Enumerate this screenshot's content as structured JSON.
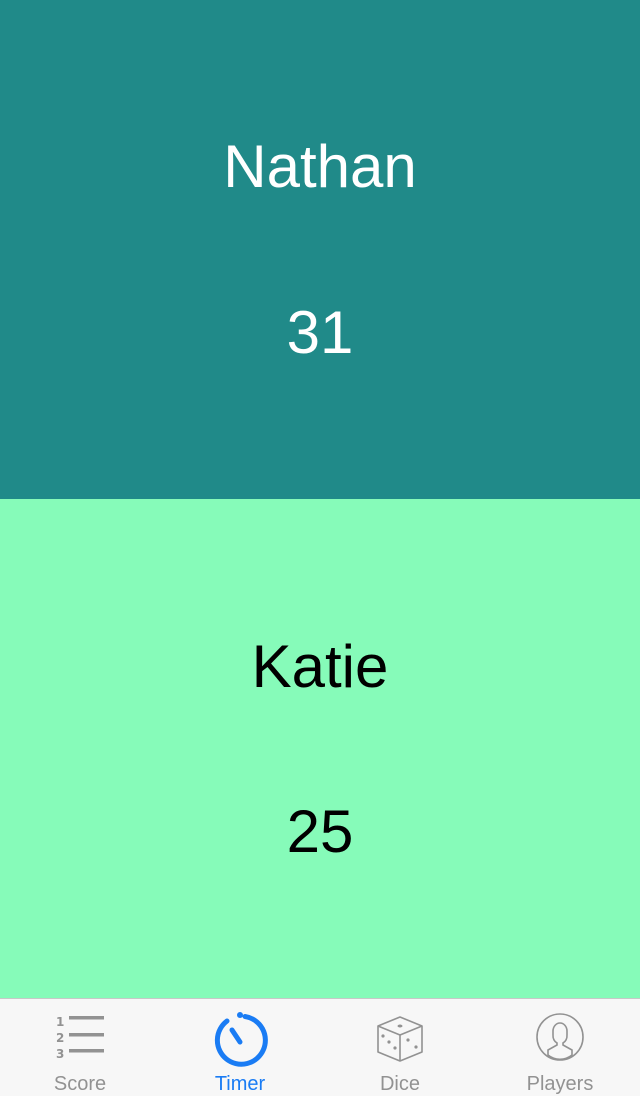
{
  "players": [
    {
      "name": "Nathan",
      "score": "31",
      "bg": "#208a89",
      "fg": "#ffffff"
    },
    {
      "name": "Katie",
      "score": "25",
      "bg": "#86fbb9",
      "fg": "#000000"
    }
  ],
  "tabbar": {
    "active_color": "#1a7cf4",
    "inactive_color": "#929292",
    "tabs": [
      {
        "label": "Score",
        "icon": "numbered-list-icon",
        "active": false
      },
      {
        "label": "Timer",
        "icon": "stopwatch-icon",
        "active": true
      },
      {
        "label": "Dice",
        "icon": "dice-icon",
        "active": false
      },
      {
        "label": "Players",
        "icon": "person-circle-icon",
        "active": false
      }
    ]
  }
}
